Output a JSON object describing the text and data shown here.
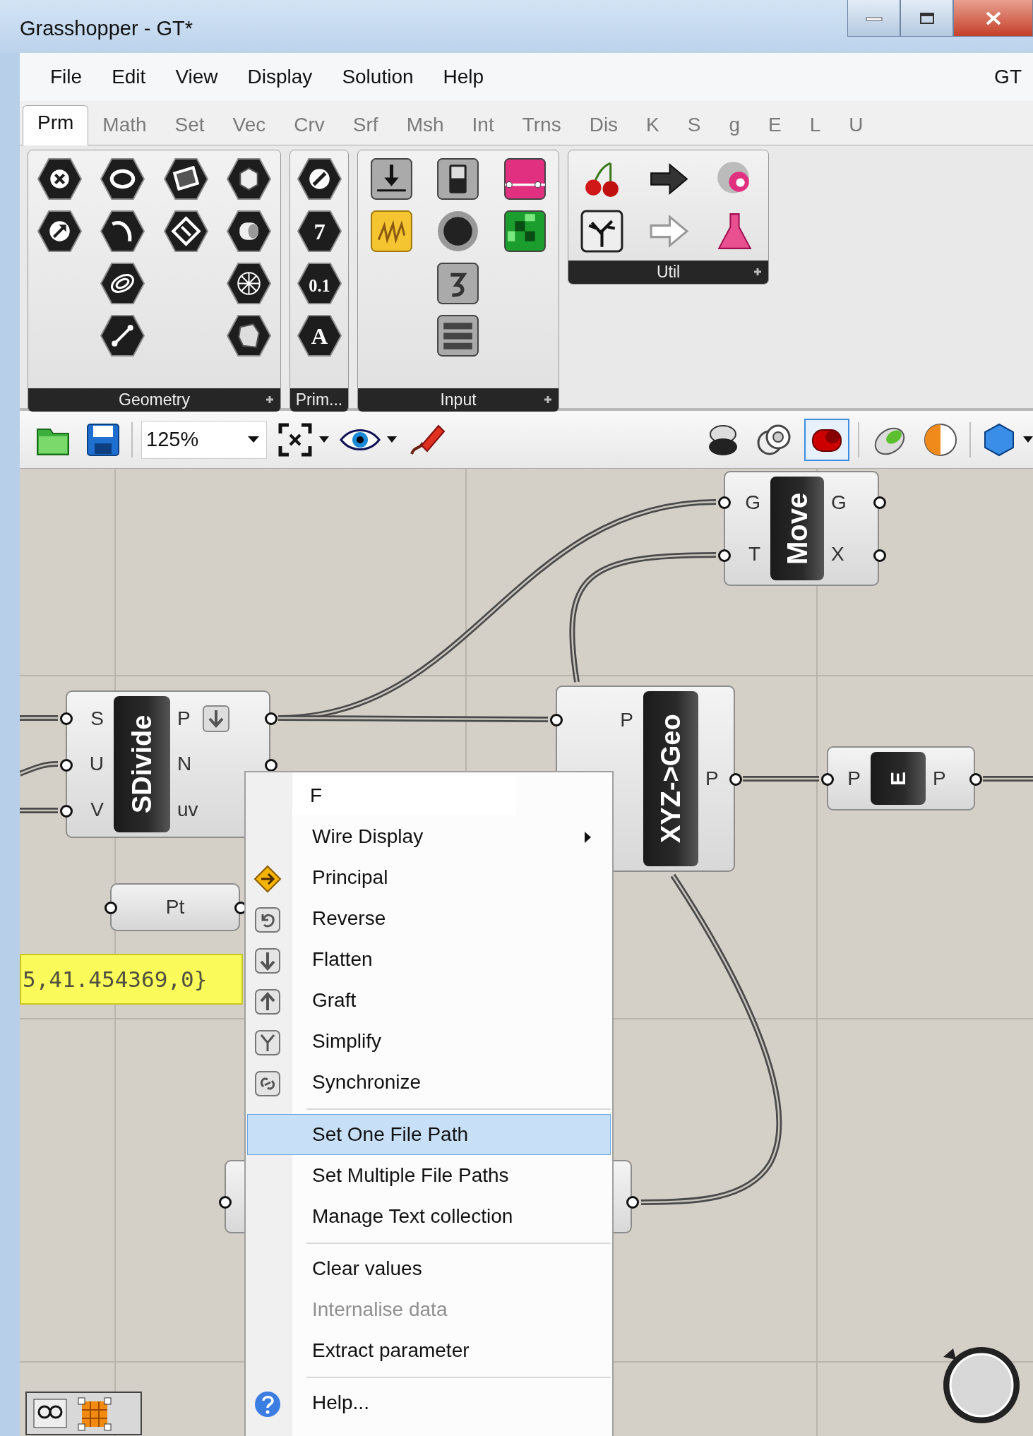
{
  "window": {
    "title": "Grasshopper - GT*"
  },
  "menu_bar": {
    "items": [
      "File",
      "Edit",
      "View",
      "Display",
      "Solution",
      "Help"
    ],
    "document": "GT"
  },
  "tabs": [
    {
      "label": "Prm",
      "selected": true
    },
    {
      "label": "Math",
      "selected": false
    },
    {
      "label": "Set",
      "selected": false
    },
    {
      "label": "Vec",
      "selected": false
    },
    {
      "label": "Crv",
      "selected": false
    },
    {
      "label": "Srf",
      "selected": false
    },
    {
      "label": "Msh",
      "selected": false
    },
    {
      "label": "Int",
      "selected": false
    },
    {
      "label": "Trns",
      "selected": false
    },
    {
      "label": "Dis",
      "selected": false
    },
    {
      "label": "K",
      "selected": false
    },
    {
      "label": "S",
      "selected": false
    },
    {
      "label": "g",
      "selected": false
    },
    {
      "label": "E",
      "selected": false
    },
    {
      "label": "L",
      "selected": false
    },
    {
      "label": "U",
      "selected": false
    }
  ],
  "ribbon_groups": [
    {
      "label": "Geometry",
      "expandable": true
    },
    {
      "label": "Prim...",
      "expandable": false,
      "glyphs": [
        "7",
        "0.1",
        "A"
      ]
    },
    {
      "label": "Input",
      "expandable": true
    },
    {
      "label": "Util",
      "expandable": true
    }
  ],
  "canvas_toolbar": {
    "zoom": "125%",
    "preview_modes": [
      {
        "selected": false
      },
      {
        "selected": false
      },
      {
        "selected": true
      }
    ]
  },
  "canvas": {
    "nodes": [
      {
        "kind": "component",
        "label": "Move",
        "inputs": [
          "G",
          "T"
        ],
        "outputs": [
          {
            "label": "G",
            "flattened": false
          },
          {
            "label": "X",
            "flattened": false
          }
        ]
      },
      {
        "kind": "component",
        "label": "SDivide",
        "inputs": [
          "S",
          "U",
          "V"
        ],
        "outputs": [
          {
            "label": "P",
            "flattened": true
          },
          {
            "label": "N",
            "flattened": false
          },
          {
            "label": "uv",
            "flattened": false
          }
        ]
      },
      {
        "kind": "component",
        "label": "XYZ->Geo",
        "inputs": [
          "P"
        ],
        "outputs": [
          {
            "label": "P",
            "flattened": false
          }
        ]
      },
      {
        "kind": "component",
        "label": "E",
        "inputs": [
          "P"
        ],
        "outputs": [
          {
            "label": "P",
            "flattened": false
          }
        ]
      },
      {
        "kind": "param",
        "label": "Pt"
      },
      {
        "kind": "panel",
        "text": "5,41.454369,0}"
      }
    ]
  },
  "context_menu": {
    "items": [
      {
        "kind": "field",
        "value": "F"
      },
      {
        "kind": "submenu",
        "label": "Wire Display",
        "selected": false,
        "disabled": false
      },
      {
        "kind": "command",
        "label": "Principal",
        "selected": false,
        "disabled": false
      },
      {
        "kind": "command",
        "label": "Reverse",
        "selected": false,
        "disabled": false
      },
      {
        "kind": "command",
        "label": "Flatten",
        "selected": false,
        "disabled": false
      },
      {
        "kind": "command",
        "label": "Graft",
        "selected": false,
        "disabled": false
      },
      {
        "kind": "command",
        "label": "Simplify",
        "selected": false,
        "disabled": false
      },
      {
        "kind": "command",
        "label": "Synchronize",
        "selected": false,
        "disabled": false
      },
      {
        "kind": "separator"
      },
      {
        "kind": "command",
        "label": "Set One File Path",
        "selected": true,
        "disabled": false
      },
      {
        "kind": "command",
        "label": "Set Multiple File Paths",
        "selected": false,
        "disabled": false
      },
      {
        "kind": "command",
        "label": "Manage Text collection",
        "selected": false,
        "disabled": false
      },
      {
        "kind": "separator"
      },
      {
        "kind": "command",
        "label": "Clear values",
        "selected": false,
        "disabled": false
      },
      {
        "kind": "command",
        "label": "Internalise data",
        "selected": false,
        "disabled": true
      },
      {
        "kind": "command",
        "label": "Extract parameter",
        "selected": false,
        "disabled": false
      },
      {
        "kind": "separator"
      },
      {
        "kind": "command",
        "label": "Help...",
        "selected": false,
        "disabled": false
      }
    ]
  }
}
